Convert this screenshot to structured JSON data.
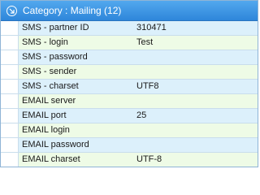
{
  "group": {
    "label": "Category : Mailing (12)"
  },
  "rows": [
    {
      "name": "SMS - partner ID",
      "value": "310471"
    },
    {
      "name": "SMS - login",
      "value": "Test"
    },
    {
      "name": "SMS - password",
      "value": ""
    },
    {
      "name": "SMS - sender",
      "value": ""
    },
    {
      "name": "SMS - charset",
      "value": "UTF8"
    },
    {
      "name": "EMAIL server",
      "value": ""
    },
    {
      "name": "EMAIL port",
      "value": "25"
    },
    {
      "name": "EMAIL login",
      "value": ""
    },
    {
      "name": "EMAIL password",
      "value": ""
    },
    {
      "name": "EMAIL charset",
      "value": "UTF-8"
    }
  ],
  "colors": {
    "header": "#2e86da",
    "row_blue": "#dcf0fb",
    "row_green": "#eefbe6",
    "grid_line": "#c9ddec"
  },
  "icons": {
    "group_toggle": "chevron-collapse-icon"
  }
}
